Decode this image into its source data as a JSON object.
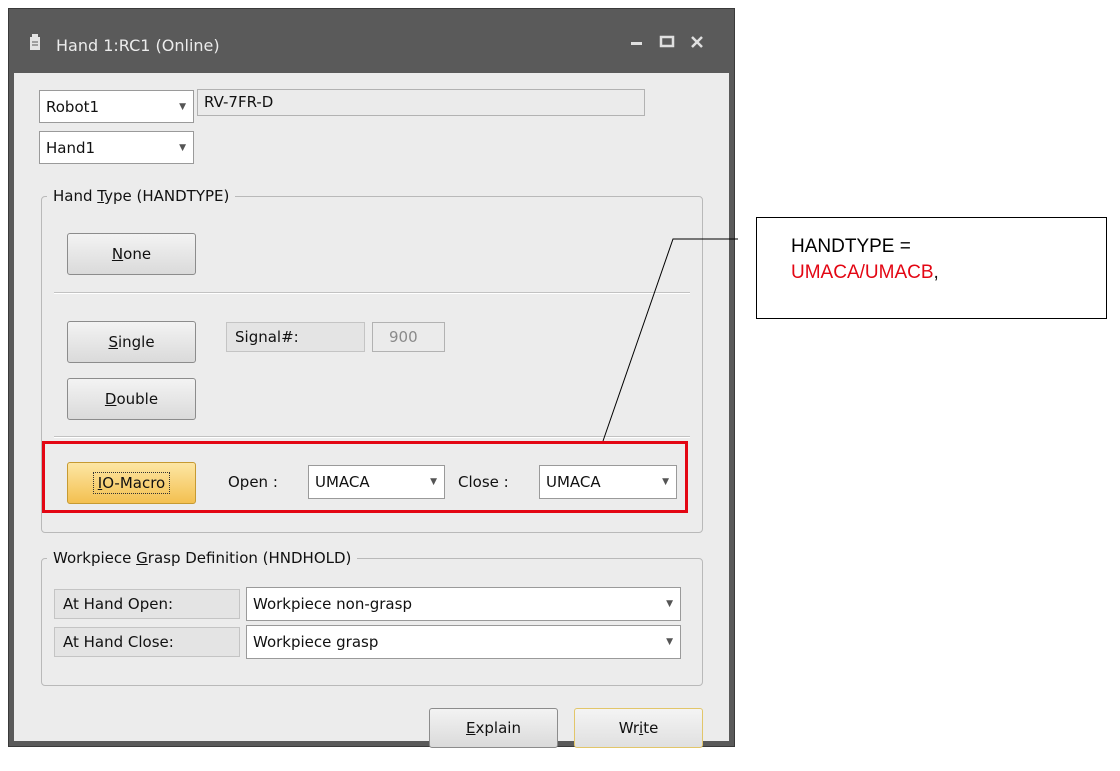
{
  "window": {
    "title": "Hand 1:RC1 (Online)",
    "icon": "document-icon",
    "controls": [
      "minimize-icon",
      "maximize-icon",
      "close-icon"
    ]
  },
  "robot_select": {
    "value": "Robot1"
  },
  "robot_model": {
    "value": "RV-7FR-D"
  },
  "hand_select": {
    "value": "Hand1"
  },
  "hand_type": {
    "legend": {
      "pre": "Hand ",
      "key": "T",
      "post": "ype (HANDTYPE)"
    },
    "none_button": {
      "key": "N",
      "rest": "one"
    },
    "single_button": {
      "key": "S",
      "rest": "ingle"
    },
    "double_button": {
      "key": "D",
      "rest": "ouble"
    },
    "signal_label": "Signal#:",
    "signal_value": "900",
    "io_macro_button": {
      "key": "I",
      "rest": "O-Macro"
    },
    "open_label": "Open :",
    "open_value": "UMACA",
    "close_label": "Close :",
    "close_value": "UMACA"
  },
  "grasp": {
    "legend": {
      "pre": "Workpiece ",
      "key": "G",
      "post": "rasp Definition (HNDHOLD)"
    },
    "rows": [
      {
        "label": "At Hand Open:",
        "value": "Workpiece non-grasp"
      },
      {
        "label": "At Hand Close:",
        "value": "Workpiece grasp"
      }
    ]
  },
  "footer": {
    "explain_button": {
      "key": "E",
      "rest": "xplain"
    },
    "write_button": {
      "pre": "Wr",
      "key": "i",
      "post": "te"
    }
  },
  "annotation": {
    "line1": "HANDTYPE =",
    "line2_red": "UMACA/UMACB",
    "line2_suffix": ",",
    "highlight_color": "#e30613"
  }
}
